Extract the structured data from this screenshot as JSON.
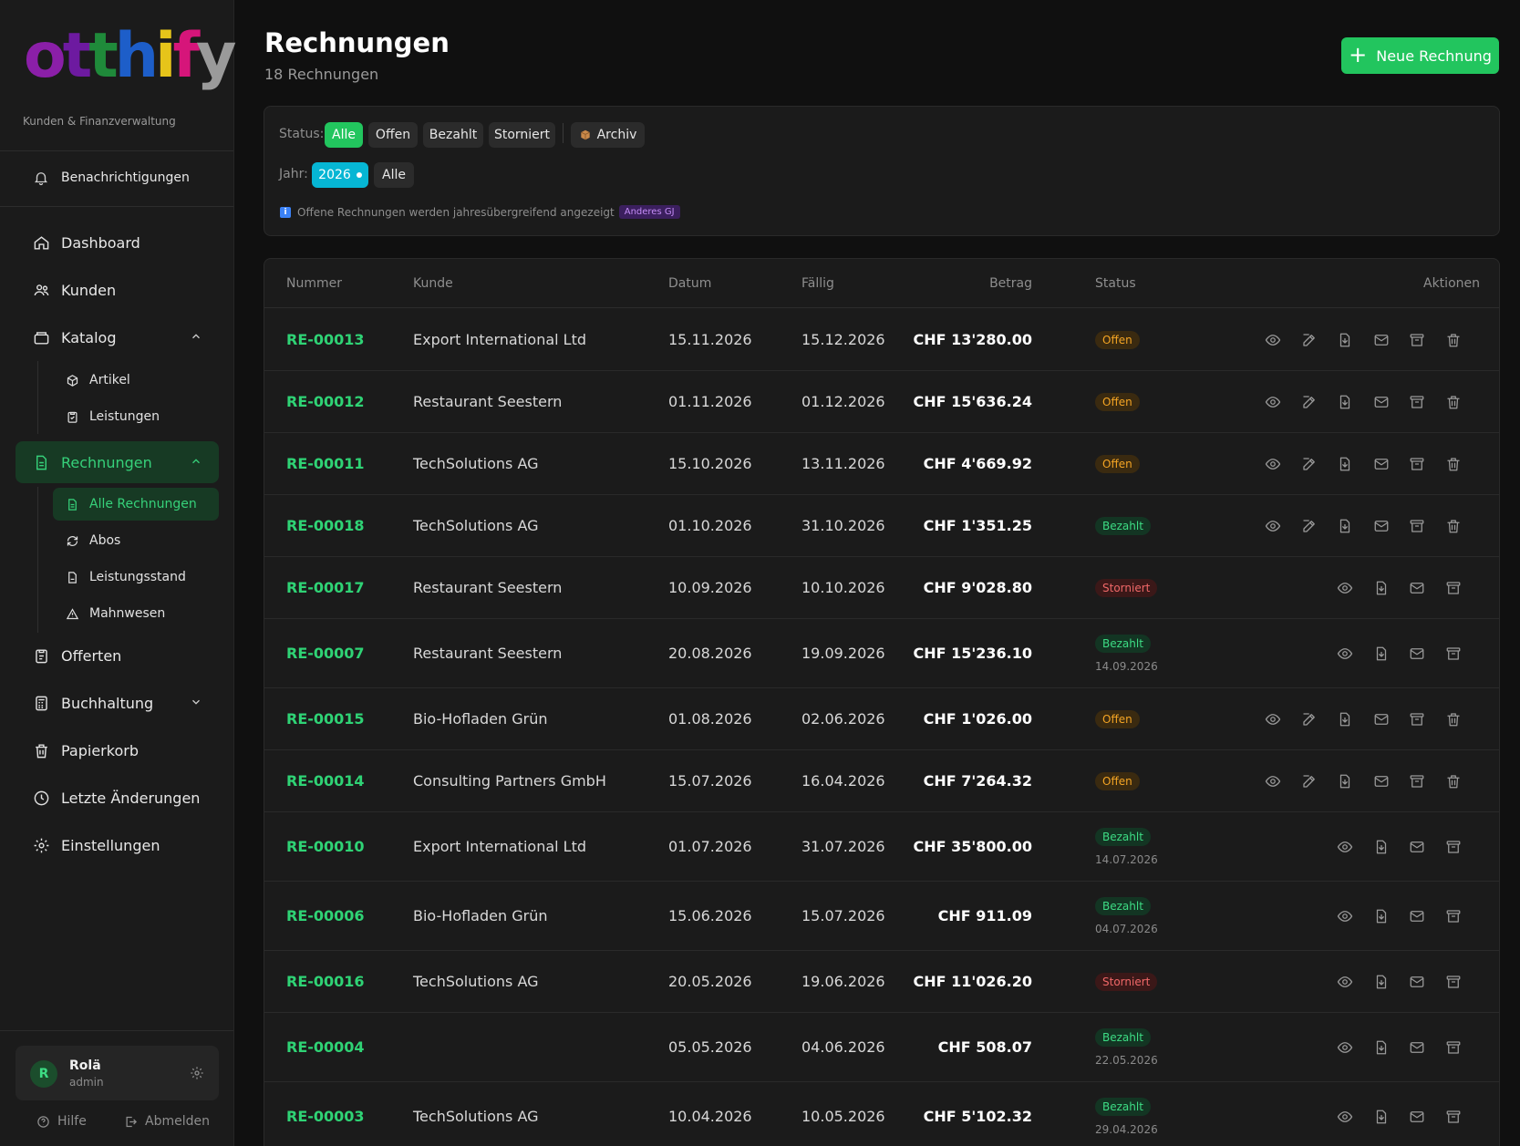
{
  "brand": {
    "logo_letters": [
      "o",
      "t",
      "t",
      "h",
      "i",
      "f",
      "y"
    ],
    "logo_colors": [
      "#8b1fa8",
      "#6d1aa0",
      "#1f8a3a",
      "#1d5ec9",
      "#e6c41a",
      "#d6157a",
      "#9a9a9a"
    ],
    "tagline": "Kunden & Finanzverwaltung"
  },
  "sidebar": {
    "notifications": "Benachrichtigungen",
    "items": {
      "dashboard": "Dashboard",
      "kunden": "Kunden",
      "katalog": "Katalog",
      "artikel": "Artikel",
      "leistungen": "Leistungen",
      "rechnungen": "Rechnungen",
      "alle_rechnungen": "Alle Rechnungen",
      "abos": "Abos",
      "leistungsstand": "Leistungsstand",
      "mahnwesen": "Mahnwesen",
      "offerten": "Offerten",
      "buchhaltung": "Buchhaltung",
      "papierkorb": "Papierkorb",
      "letzte_aenderungen": "Letzte Änderungen",
      "einstellungen": "Einstellungen"
    },
    "user": {
      "initial": "R",
      "name": "Rolä",
      "role": "admin"
    },
    "footer": {
      "help": "Hilfe",
      "logout": "Abmelden"
    }
  },
  "header": {
    "title": "Rechnungen",
    "count": "18 Rechnungen",
    "new_button": "Neue Rechnung"
  },
  "filters": {
    "status_label": "Status:",
    "status_options": [
      "Alle",
      "Offen",
      "Bezahlt",
      "Storniert"
    ],
    "archive": "Archiv",
    "year_label": "Jahr:",
    "year_selected": "2026",
    "year_all": "Alle",
    "info": "Offene Rechnungen werden jahresübergreifend angezeigt",
    "info_badge": "Anderes GJ"
  },
  "table": {
    "columns": {
      "nummer": "Nummer",
      "kunde": "Kunde",
      "datum": "Datum",
      "faellig": "Fällig",
      "betrag": "Betrag",
      "status": "Status",
      "aktionen": "Aktionen"
    },
    "rows": [
      {
        "nummer": "RE-00013",
        "kunde": "Export International Ltd",
        "datum": "15.11.2026",
        "faellig": "15.12.2026",
        "betrag": "CHF 13'280.00",
        "status": "Offen",
        "paid": ""
      },
      {
        "nummer": "RE-00012",
        "kunde": "Restaurant Seestern",
        "datum": "01.11.2026",
        "faellig": "01.12.2026",
        "betrag": "CHF 15'636.24",
        "status": "Offen",
        "paid": ""
      },
      {
        "nummer": "RE-00011",
        "kunde": "TechSolutions AG",
        "datum": "15.10.2026",
        "faellig": "13.11.2026",
        "betrag": "CHF 4'669.92",
        "status": "Offen",
        "paid": ""
      },
      {
        "nummer": "RE-00018",
        "kunde": "TechSolutions AG",
        "datum": "01.10.2026",
        "faellig": "31.10.2026",
        "betrag": "CHF 1'351.25",
        "status": "Bezahlt",
        "paid": ""
      },
      {
        "nummer": "RE-00017",
        "kunde": "Restaurant Seestern",
        "datum": "10.09.2026",
        "faellig": "10.10.2026",
        "betrag": "CHF 9'028.80",
        "status": "Storniert",
        "paid": ""
      },
      {
        "nummer": "RE-00007",
        "kunde": "Restaurant Seestern",
        "datum": "20.08.2026",
        "faellig": "19.09.2026",
        "betrag": "CHF 15'236.10",
        "status": "Bezahlt",
        "paid": "14.09.2026"
      },
      {
        "nummer": "RE-00015",
        "kunde": "Bio-Hofladen Grün",
        "datum": "01.08.2026",
        "faellig": "02.06.2026",
        "betrag": "CHF 1'026.00",
        "status": "Offen",
        "paid": ""
      },
      {
        "nummer": "RE-00014",
        "kunde": "Consulting Partners GmbH",
        "datum": "15.07.2026",
        "faellig": "16.04.2026",
        "betrag": "CHF 7'264.32",
        "status": "Offen",
        "paid": ""
      },
      {
        "nummer": "RE-00010",
        "kunde": "Export International Ltd",
        "datum": "01.07.2026",
        "faellig": "31.07.2026",
        "betrag": "CHF 35'800.00",
        "status": "Bezahlt",
        "paid": "14.07.2026"
      },
      {
        "nummer": "RE-00006",
        "kunde": "Bio-Hofladen Grün",
        "datum": "15.06.2026",
        "faellig": "15.07.2026",
        "betrag": "CHF 911.09",
        "status": "Bezahlt",
        "paid": "04.07.2026"
      },
      {
        "nummer": "RE-00016",
        "kunde": "TechSolutions AG",
        "datum": "20.05.2026",
        "faellig": "19.06.2026",
        "betrag": "CHF 11'026.20",
        "status": "Storniert",
        "paid": ""
      },
      {
        "nummer": "RE-00004",
        "kunde": "",
        "datum": "05.05.2026",
        "faellig": "04.06.2026",
        "betrag": "CHF 508.07",
        "status": "Bezahlt",
        "paid": "22.05.2026"
      },
      {
        "nummer": "RE-00003",
        "kunde": "TechSolutions AG",
        "datum": "10.04.2026",
        "faellig": "10.05.2026",
        "betrag": "CHF 5'102.32",
        "status": "Bezahlt",
        "paid": "29.04.2026"
      }
    ]
  },
  "colors": {
    "accent": "#22c55e",
    "offen": "#f5a524",
    "bezahlt": "#3ddc84",
    "storniert": "#f06868",
    "year_chip": "#06b6d4"
  }
}
